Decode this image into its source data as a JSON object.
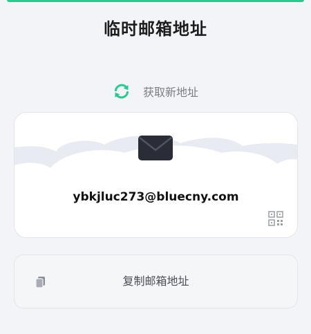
{
  "header": {
    "title": "临时邮箱地址"
  },
  "refresh": {
    "label": "获取新地址",
    "icon": "refresh-icon"
  },
  "email_card": {
    "address": "ybkjluc273@bluecny.com",
    "mail_icon": "envelope-icon",
    "qr_icon": "qr-code-icon"
  },
  "copy": {
    "label": "复制邮箱地址",
    "icon": "copy-icon"
  },
  "colors": {
    "accent": "#2ec990",
    "background": "#f3f4f7",
    "card": "#ffffff"
  }
}
